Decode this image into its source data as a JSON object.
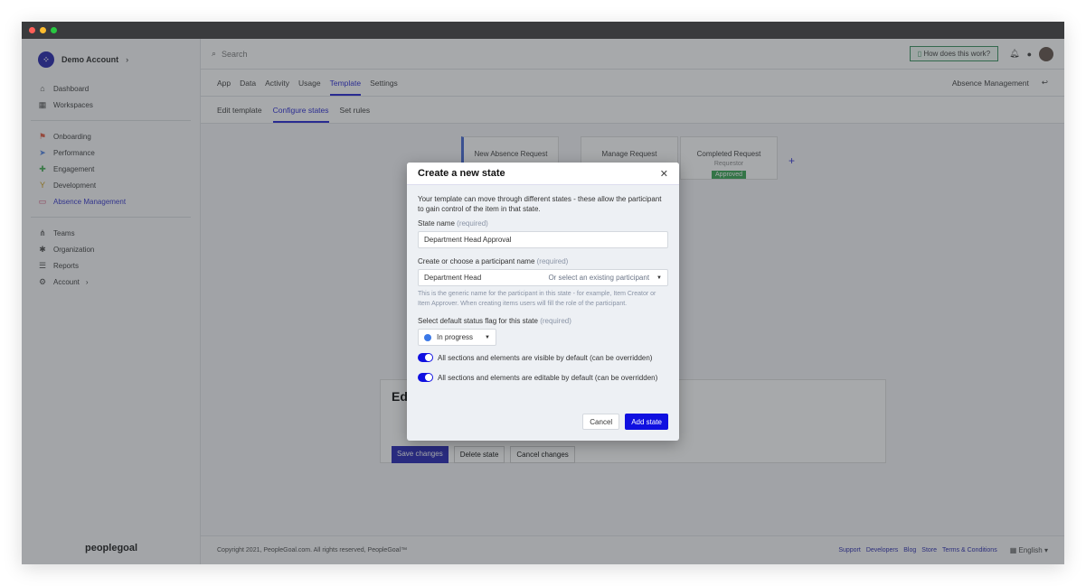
{
  "account": "Demo Account",
  "sidebar": {
    "top": [
      {
        "icon": "home-icon",
        "label": "Dashboard"
      },
      {
        "icon": "grid-icon",
        "label": "Workspaces"
      }
    ],
    "workspaces": [
      {
        "icon": "flag-icon",
        "label": "Onboarding",
        "color": "#e0533a"
      },
      {
        "icon": "send-icon",
        "label": "Performance",
        "color": "#4a7ee0"
      },
      {
        "icon": "puzzle-icon",
        "label": "Engagement",
        "color": "#3aa84a"
      },
      {
        "icon": "sprout-icon",
        "label": "Development",
        "color": "#c8960a"
      },
      {
        "icon": "laptop-icon",
        "label": "Absence Management",
        "color": "#d0406a",
        "active": true
      }
    ],
    "bottom": [
      {
        "icon": "hierarchy-icon",
        "label": "Teams"
      },
      {
        "icon": "network-icon",
        "label": "Organization"
      },
      {
        "icon": "table-icon",
        "label": "Reports"
      },
      {
        "icon": "gear-icon",
        "label": "Account"
      }
    ],
    "brand": "peoplegoal"
  },
  "topbar": {
    "search_placeholder": "Search",
    "help": "How does this work?"
  },
  "tabs": [
    "App",
    "Data",
    "Activity",
    "Usage",
    "Template",
    "Settings"
  ],
  "active_tab": "Template",
  "context": "Absence Management",
  "subtabs": [
    "Edit template",
    "Configure states",
    "Set rules"
  ],
  "active_subtab": "Configure states",
  "states": [
    {
      "name": "New Absence Request"
    },
    {
      "name": "Manage Request"
    },
    {
      "name": "Completed Request",
      "participant": "Requestor",
      "badge": "Approved"
    }
  ],
  "edit_panel": {
    "title": "Ed",
    "buttons": [
      "Save changes",
      "Delete state",
      "Cancel changes"
    ]
  },
  "modal": {
    "title": "Create a new state",
    "intro": "Your template can move through different states - these allow the participant to gain control of the item in that state.",
    "state_name_label": "State name",
    "required": "(required)",
    "state_name_value": "Department Head Approval",
    "participant_label": "Create or choose a participant name",
    "participant_value": "Department Head",
    "participant_select": "Or select an existing participant",
    "participant_hint": "This is the generic name for the participant in this state - for example, Item Creator or Item Approver. When creating items users will fill the role of the participant.",
    "status_label": "Select default status flag for this state",
    "status_value": "In progress",
    "status_color": "#3b78e7",
    "toggle_visible": "All sections and elements are visible by default (can be overridden)",
    "toggle_visible_on": true,
    "toggle_editable": "All sections and elements are editable by default (can be overridden)",
    "toggle_editable_on": true,
    "cancel": "Cancel",
    "submit": "Add state"
  },
  "footer": {
    "copyright": "Copyright 2021, PeopleGoal.com. All rights reserved, PeopleGoal™",
    "links": [
      "Support",
      "Developers",
      "Blog",
      "Store",
      "Terms & Conditions"
    ],
    "language": "English"
  },
  "accent": "#1010e0"
}
